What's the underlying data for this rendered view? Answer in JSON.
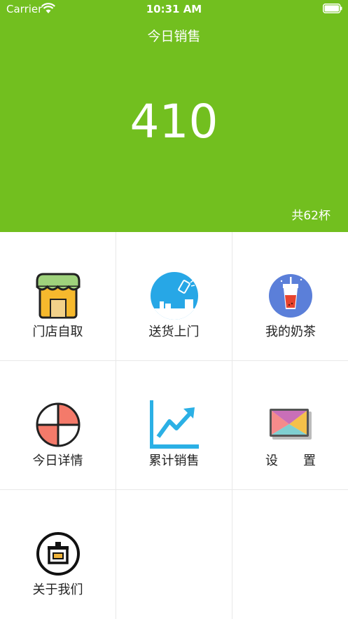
{
  "status_bar": {
    "carrier": "Carrier",
    "time": "10:31 AM"
  },
  "header": {
    "title": "今日销售",
    "sales_total": "410",
    "cup_count": "共62杯",
    "background_color": "#72bf1f"
  },
  "menu": {
    "items": [
      {
        "label": "门店自取",
        "icon": "store-icon"
      },
      {
        "label": "送货上门",
        "icon": "delivery-icon"
      },
      {
        "label": "我的奶茶",
        "icon": "milk-tea-icon"
      },
      {
        "label": "今日详情",
        "icon": "pie-chart-icon"
      },
      {
        "label": "累计销售",
        "icon": "trend-chart-icon"
      },
      {
        "label": "设　　置",
        "icon": "settings-envelope-icon"
      },
      {
        "label": "关于我们",
        "icon": "about-us-icon"
      }
    ]
  }
}
